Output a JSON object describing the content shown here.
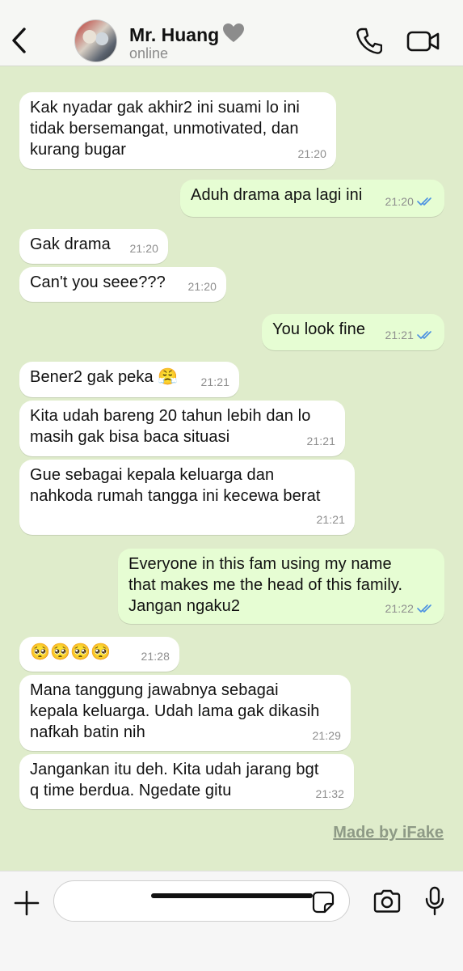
{
  "header": {
    "contact_name": "Mr. Huang",
    "status": "online",
    "heart_color": "#8c8c8c"
  },
  "messages": [
    {
      "dir": "in",
      "text": "Kak nyadar gak akhir2 ini suami lo ini\ntidak bersemangat, unmotivated, dan\nkurang bugar",
      "time": "21:20"
    },
    {
      "dir": "out",
      "text": "Aduh drama apa lagi ini",
      "time": "21:20",
      "read": true
    },
    {
      "dir": "in",
      "text": "Gak drama",
      "time": "21:20"
    },
    {
      "dir": "in",
      "text": "Can't you seee???",
      "time": "21:20"
    },
    {
      "dir": "out",
      "text": "You look fine",
      "time": "21:21",
      "read": true
    },
    {
      "dir": "in",
      "text": "Bener2 gak peka 😤",
      "time": "21:21"
    },
    {
      "dir": "in",
      "text": "Kita udah bareng 20 tahun lebih dan lo\nmasih gak bisa baca situasi",
      "time": "21:21"
    },
    {
      "dir": "in",
      "text": "Gue sebagai kepala keluarga dan\nnahkoda rumah tangga ini kecewa berat",
      "time": "21:21"
    },
    {
      "dir": "out",
      "text": "Everyone in this fam using my name\nthat makes me the head of this family.\nJangan ngaku2",
      "time": "21:22",
      "read": true
    },
    {
      "dir": "in",
      "text": "🥺🥺🥺🥺",
      "time": "21:28"
    },
    {
      "dir": "in",
      "text": "Mana tanggung jawabnya sebagai\nkepala keluarga. Udah lama gak dikasih\nnafkah batin nih",
      "time": "21:29"
    },
    {
      "dir": "in",
      "text": "Jangankan itu deh. Kita udah jarang bgt\nq time berdua. Ngedate gitu",
      "time": "21:32"
    }
  ],
  "watermark": "Made by iFake",
  "input": {
    "value": "",
    "placeholder": ""
  },
  "colors": {
    "chat_background": "#dfeccb",
    "incoming_bubble": "#ffffff",
    "outgoing_bubble": "#e6fdd3",
    "read_ticks": "#4a90e2"
  }
}
